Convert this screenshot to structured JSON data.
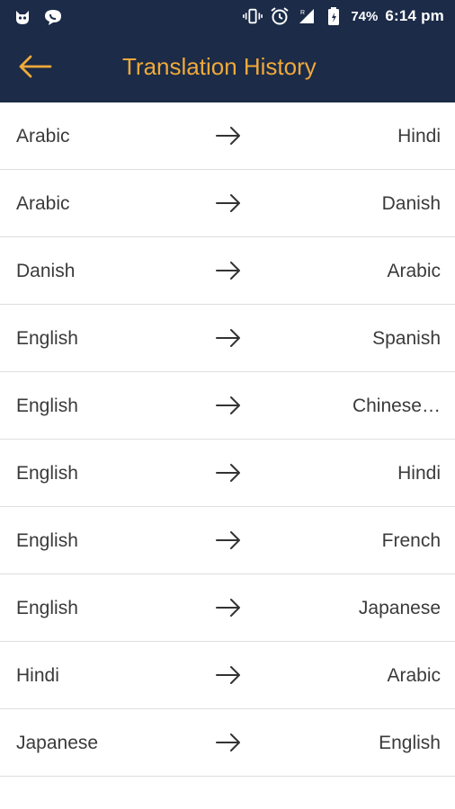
{
  "status_bar": {
    "battery": "74%",
    "time": "6:14 pm"
  },
  "app_bar": {
    "title": "Translation History",
    "back_icon": "arrow-left-icon"
  },
  "accent_color": "#f0a93a",
  "header_color": "#1b2b48",
  "history": [
    {
      "from": "Arabic",
      "to": "Hindi"
    },
    {
      "from": "Arabic",
      "to": "Danish"
    },
    {
      "from": "Danish",
      "to": "Arabic"
    },
    {
      "from": "English",
      "to": "Spanish"
    },
    {
      "from": "English",
      "to": "Chinese…"
    },
    {
      "from": "English",
      "to": "Hindi"
    },
    {
      "from": "English",
      "to": "French"
    },
    {
      "from": "English",
      "to": "Japanese"
    },
    {
      "from": "Hindi",
      "to": "Arabic"
    },
    {
      "from": "Japanese",
      "to": "English"
    }
  ]
}
